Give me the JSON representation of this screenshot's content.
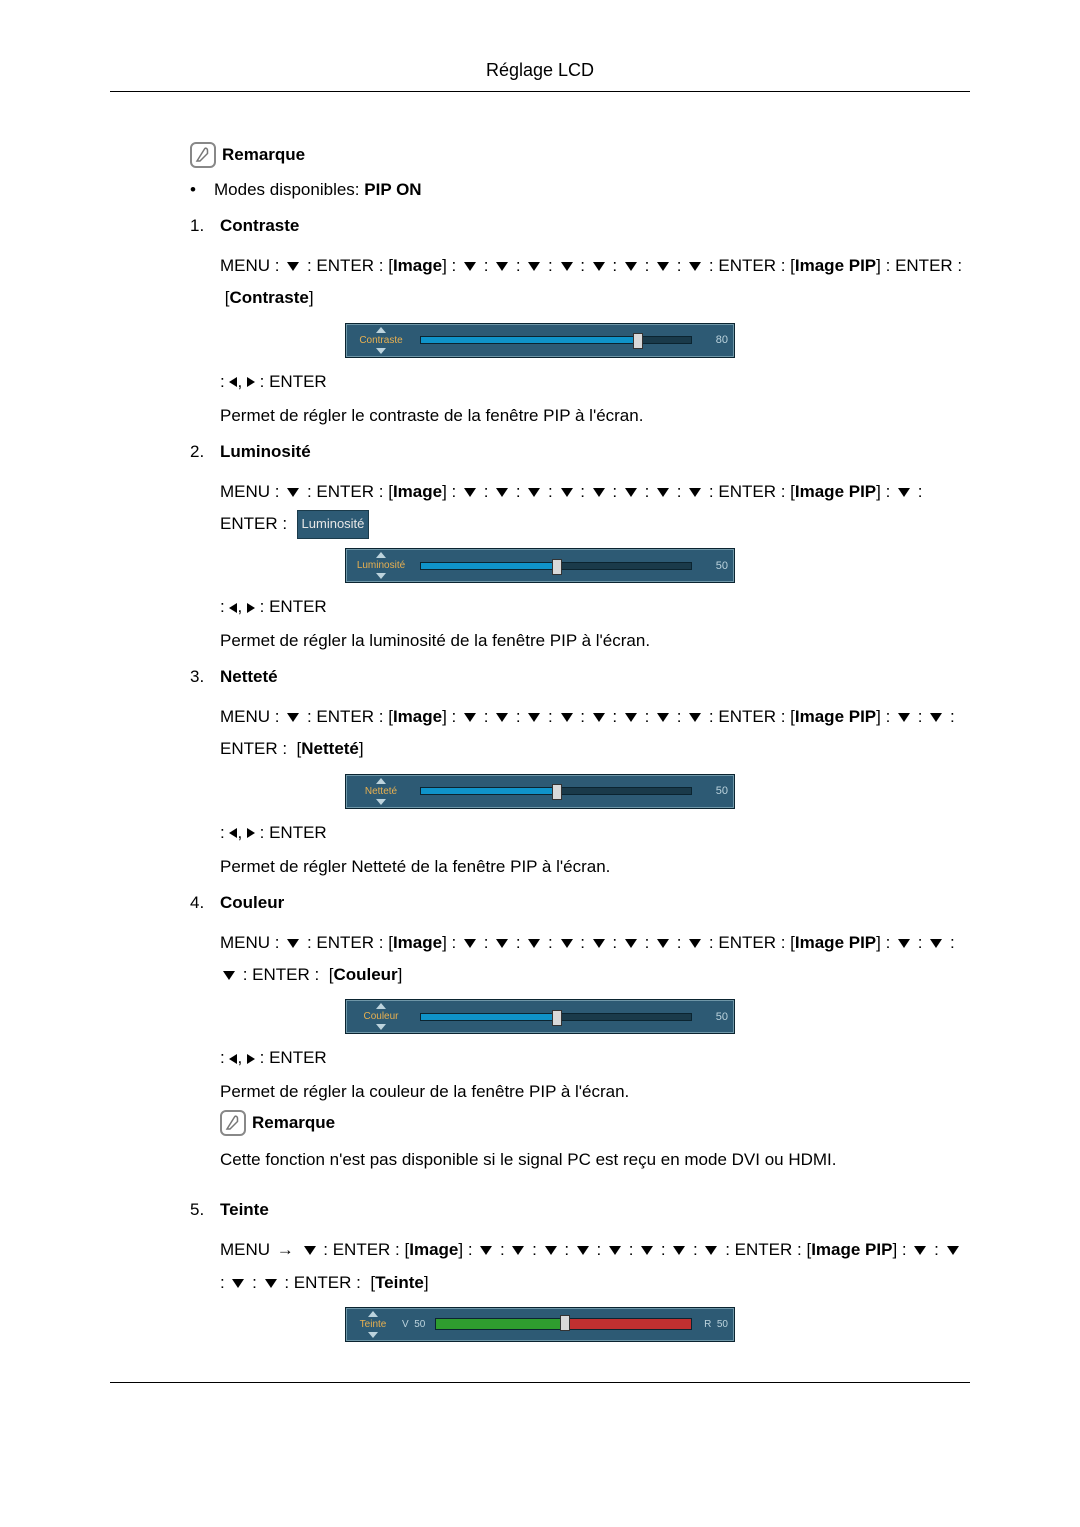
{
  "header": {
    "title": "Réglage LCD"
  },
  "note_label": "Remarque",
  "modes_prefix": "Modes disponibles: ",
  "modes_bold": "PIP ON",
  "path_tokens": {
    "menu": "MENU",
    "enter": "ENTER",
    "image": "Image",
    "image_pip": "Image PIP"
  },
  "items": [
    {
      "num": "1.",
      "title": "Contraste",
      "sub_label": "Contraste",
      "down_after_pip": 0,
      "osd": {
        "name": "Contraste",
        "value": "80",
        "percent": 80
      },
      "desc": "Permet de régler le contraste de la fenêtre PIP à l'écran."
    },
    {
      "num": "2.",
      "title": "Luminosité",
      "sub_label": "Luminosité",
      "sub_hl": true,
      "down_after_pip": 1,
      "osd": {
        "name": "Luminosité",
        "value": "50",
        "percent": 50
      },
      "desc": "Permet de régler la luminosité de la fenêtre PIP à l'écran."
    },
    {
      "num": "3.",
      "title": "Netteté",
      "sub_label": "Netteté",
      "down_after_pip": 2,
      "osd": {
        "name": "Netteté",
        "value": "50",
        "percent": 50
      },
      "desc": "Permet de régler Netteté de la fenêtre PIP à l'écran."
    },
    {
      "num": "4.",
      "title": "Couleur",
      "sub_label": "Couleur",
      "down_after_pip": 3,
      "osd": {
        "name": "Couleur",
        "value": "50",
        "percent": 50
      },
      "desc": "Permet de régler la couleur de la fenêtre PIP à l'écran.",
      "note_after": "Cette fonction n'est pas disponible si le signal PC est reçu en mode DVI ou HDMI."
    },
    {
      "num": "5.",
      "title": "Teinte",
      "sub_label": "Teinte",
      "down_after_pip": 4,
      "menu_arrow": true,
      "osd_teinte": {
        "name": "Teinte",
        "v_label": "V",
        "v_val": "50",
        "r_label": "R",
        "r_val": "50",
        "percent": 50
      }
    }
  ],
  "nav_enter": "ENTER"
}
